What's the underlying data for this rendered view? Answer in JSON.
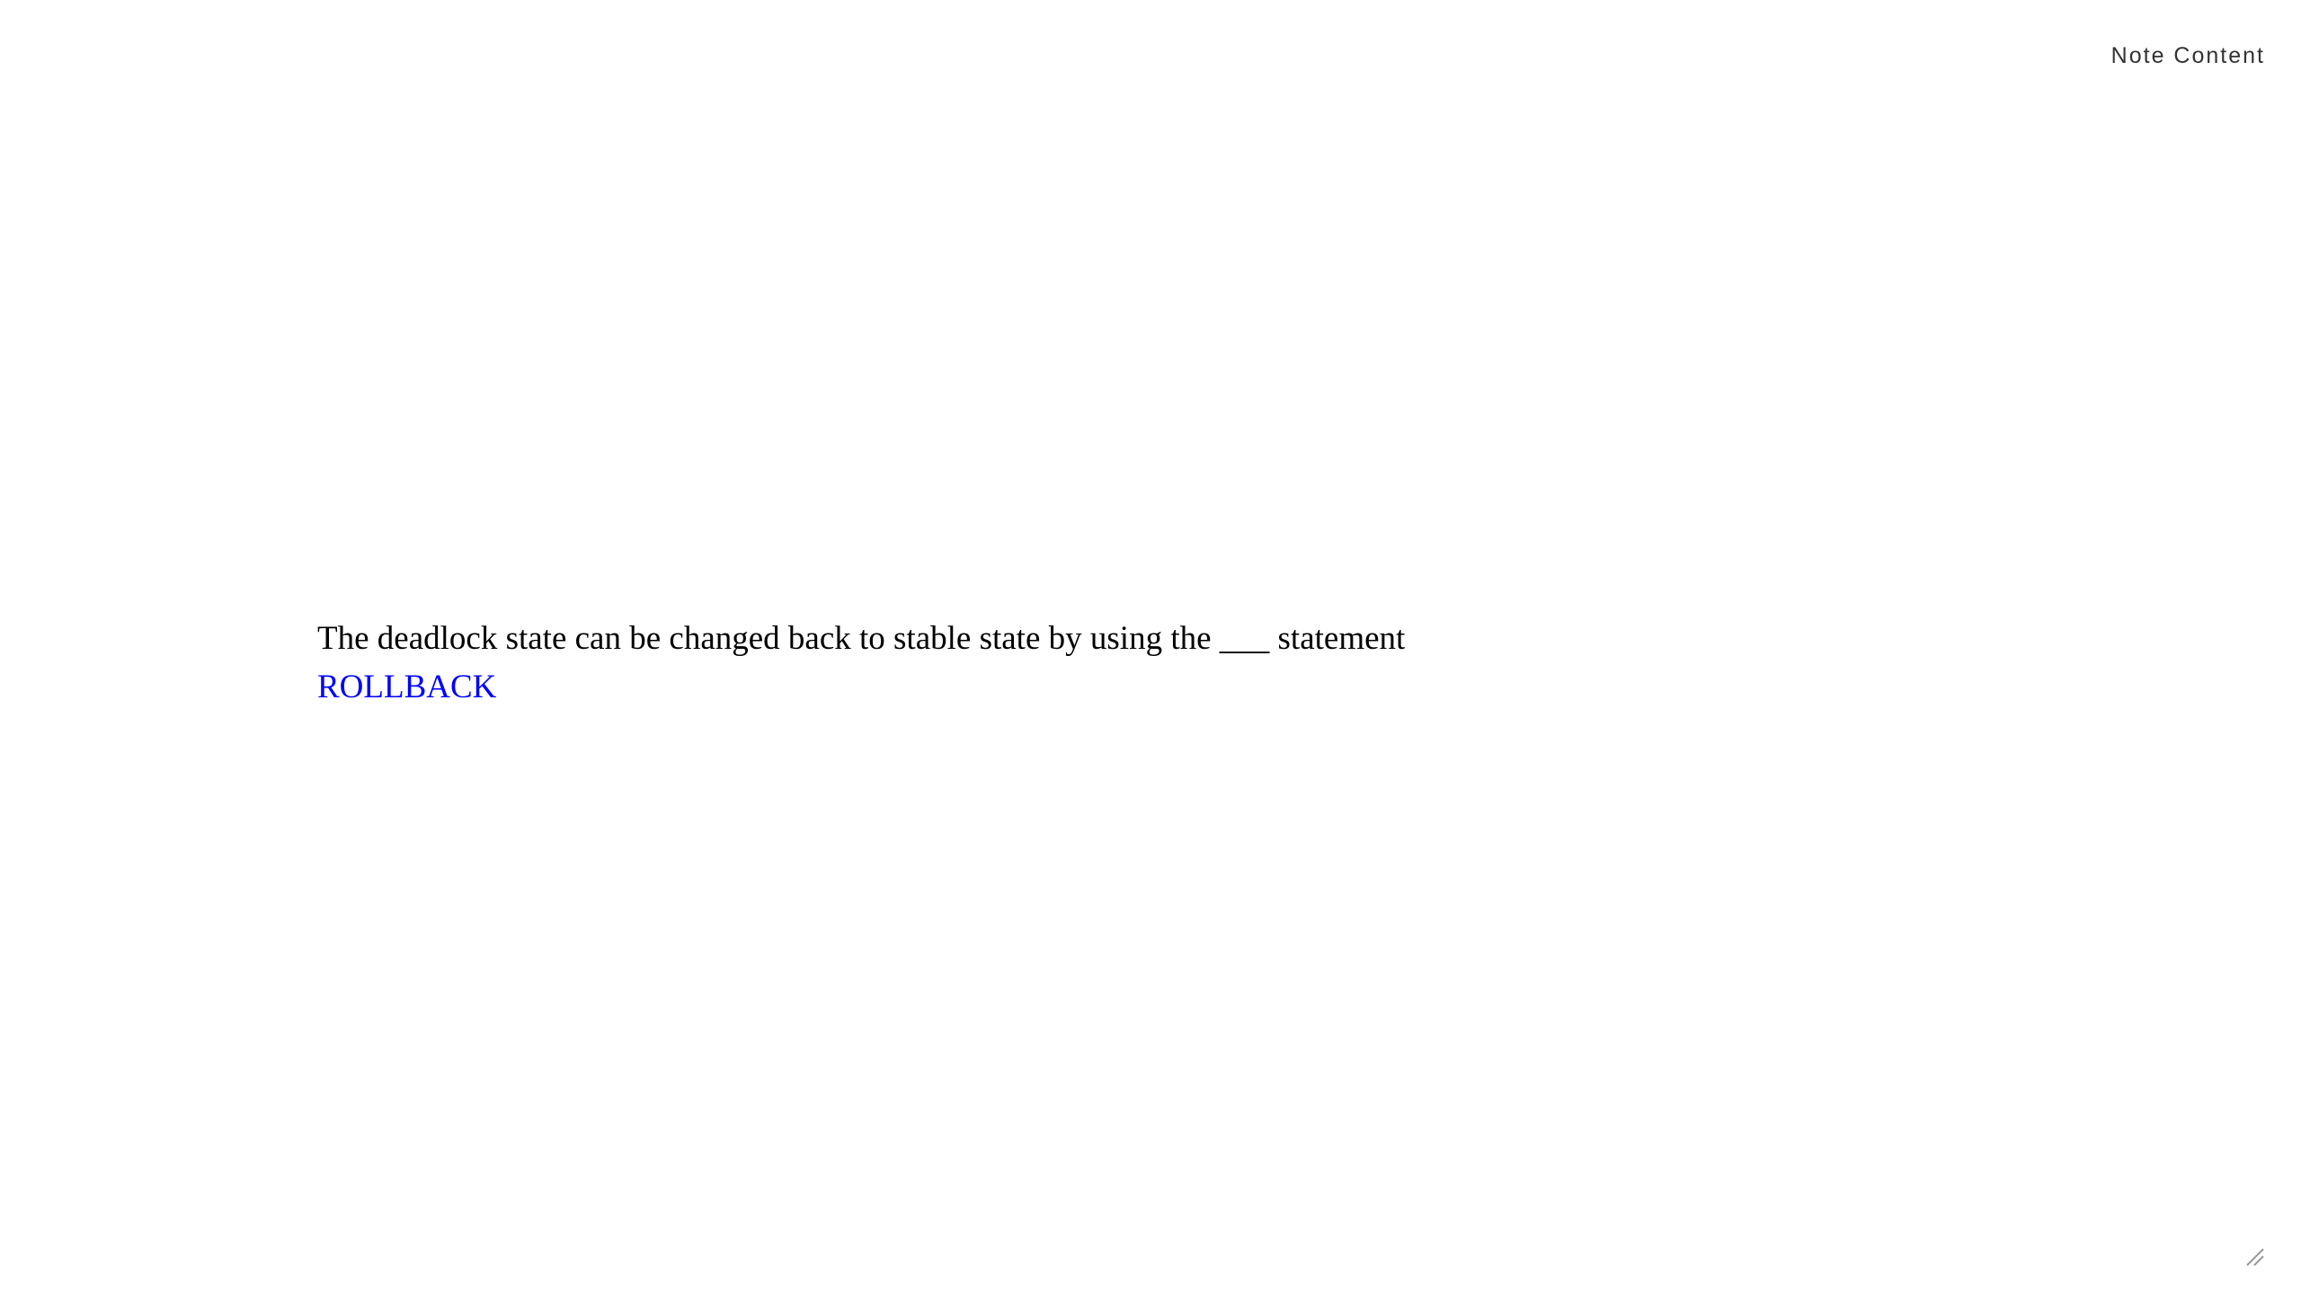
{
  "header": {
    "title": "Note Content"
  },
  "note": {
    "question": "The deadlock state can be changed back to stable state by using the ___ statement",
    "answer": "ROLLBACK"
  },
  "icons": {
    "resize": "resize-grip-icon"
  }
}
